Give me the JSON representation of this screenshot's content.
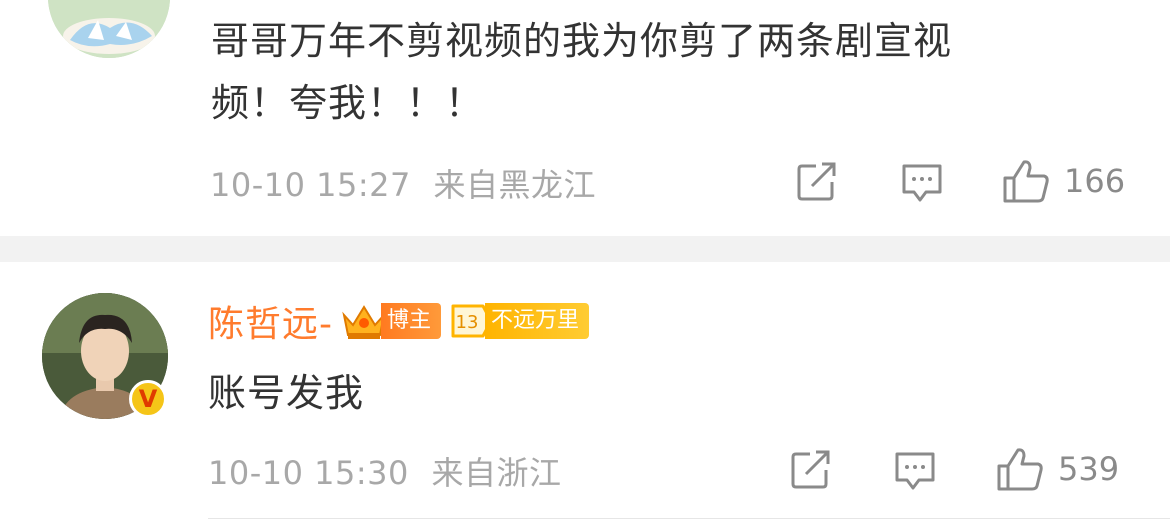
{
  "comments": [
    {
      "text_line1": "哥哥万年不剪视频的我为你剪了两条剧宣视",
      "text_line2": "频！夸我！！！",
      "time": "10-10 15:27",
      "location": "来自黑龙江",
      "likes": "166"
    },
    {
      "username": "陈哲远-",
      "blogger_badge": "博主",
      "level": "13",
      "level_badge": "不远万里",
      "verified_mark": "V",
      "text": "账号发我",
      "time": "10-10 15:30",
      "location": "来自浙江",
      "likes": "539"
    }
  ],
  "icons": {
    "share": "share-icon",
    "reply": "comment-icon",
    "like": "thumbs-up-icon"
  },
  "colors": {
    "username": "#ff7b2d",
    "blogger_badge": "#ff7a20",
    "level_badge": "#ffb400",
    "meta_text": "#a8a8a8"
  }
}
